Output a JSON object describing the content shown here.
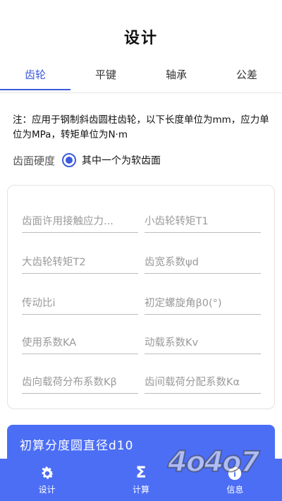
{
  "header": {
    "title": "设计"
  },
  "tabs": [
    {
      "label": "齿轮",
      "active": true
    },
    {
      "label": "平键",
      "active": false
    },
    {
      "label": "轴承",
      "active": false
    },
    {
      "label": "公差",
      "active": false
    }
  ],
  "note": "注：应用于钢制斜齿圆柱齿轮，以下长度单位为mm，应力单位为MPa，转矩单位为N·m",
  "hardness": {
    "label": "齿面硬度",
    "option": "其中一个为软齿面",
    "selected": true
  },
  "form": {
    "fields": [
      {
        "placeholder": "齿面许用接触应力..."
      },
      {
        "placeholder": "小齿轮转矩T1"
      },
      {
        "placeholder": "大齿轮转矩T2"
      },
      {
        "placeholder": "齿宽系数ψd"
      },
      {
        "placeholder": "传动比i"
      },
      {
        "placeholder": "初定螺旋角β0(°)"
      },
      {
        "placeholder": "使用系数KA"
      },
      {
        "placeholder": "动载系数Kv"
      },
      {
        "placeholder": "齿向载荷分布系数Kβ"
      },
      {
        "placeholder": "齿间载荷分配系数Kα"
      }
    ]
  },
  "calc_button": {
    "label": "初算分度圆直径d10"
  },
  "bottom_nav": [
    {
      "label": "设计",
      "icon": "gear-icon"
    },
    {
      "label": "计算",
      "icon": "sigma-icon"
    },
    {
      "label": "信息",
      "icon": "info-icon"
    }
  ],
  "watermark": "4o4o7",
  "colors": {
    "accent": "#4c6ef5",
    "tab_active": "#3b5bdb"
  }
}
